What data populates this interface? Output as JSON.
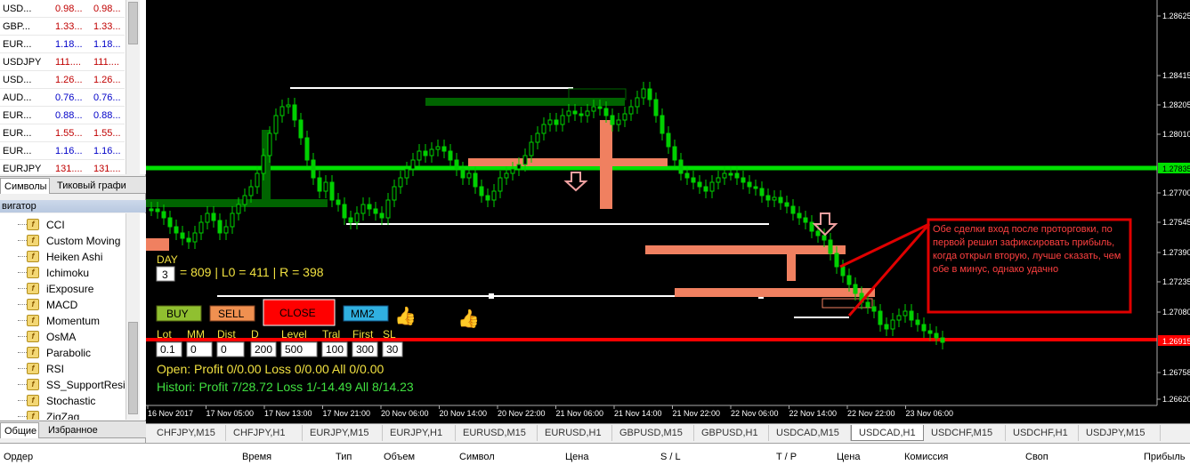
{
  "market_watch": {
    "rows": [
      {
        "symbol": "USD...",
        "bid": "0.98...",
        "ask": "0.98...",
        "up": false
      },
      {
        "symbol": "GBP...",
        "bid": "1.33...",
        "ask": "1.33...",
        "up": false
      },
      {
        "symbol": "EUR...",
        "bid": "1.18...",
        "ask": "1.18...",
        "up": true
      },
      {
        "symbol": "USDJPY",
        "bid": "111....",
        "ask": "111....",
        "up": false
      },
      {
        "symbol": "USD...",
        "bid": "1.26...",
        "ask": "1.26...",
        "up": false
      },
      {
        "symbol": "AUD...",
        "bid": "0.76...",
        "ask": "0.76...",
        "up": true
      },
      {
        "symbol": "EUR...",
        "bid": "0.88...",
        "ask": "0.88...",
        "up": true
      },
      {
        "symbol": "EUR...",
        "bid": "1.55...",
        "ask": "1.55...",
        "up": false
      },
      {
        "symbol": "EUR...",
        "bid": "1.16...",
        "ask": "1.16...",
        "up": true
      },
      {
        "symbol": "EURJPY",
        "bid": "131....",
        "ask": "131....",
        "up": false
      }
    ],
    "tabs": [
      "Символы",
      "Тиковый графи"
    ]
  },
  "navigator": {
    "title": "вигатор",
    "items": [
      "CCI",
      "Custom Moving",
      "Heiken Ashi",
      "Ichimoku",
      "iExposure",
      "MACD",
      "Momentum",
      "OsMA",
      "Parabolic",
      "RSI",
      "SS_SupportResist",
      "Stochastic",
      "ZigZag"
    ],
    "tabs": [
      "Общие",
      "Избранное"
    ],
    "icon_letter": "f"
  },
  "chart": {
    "price_labels": [
      "1.28625",
      "1.28415",
      "1.28205",
      "1.28010",
      "1.27700",
      "1.27545",
      "1.27390",
      "1.27235",
      "1.27080",
      "1.26758",
      "1.26620"
    ],
    "price_highlight_green": "1.27835",
    "price_highlight_red": "1.26915",
    "time_labels": [
      "16 Nov 2017",
      "17 Nov 05:00",
      "17 Nov 13:00",
      "17 Nov 21:00",
      "20 Nov 06:00",
      "20 Nov 14:00",
      "20 Nov 22:00",
      "21 Nov 06:00",
      "21 Nov 14:00",
      "21 Nov 22:00",
      "22 Nov 06:00",
      "22 Nov 14:00",
      "22 Nov 22:00",
      "23 Nov 06:00"
    ],
    "panel": {
      "day_label": "DAY",
      "day_value": "3",
      "stats": "= 809 | L0 = 411 | R = 398",
      "buttons": {
        "buy": "BUY",
        "sell": "SELL",
        "close": "CLOSE",
        "mm2": "MM2"
      },
      "param_labels": [
        "Lot",
        "MM",
        "Dist",
        "D",
        "Level",
        "Tral",
        "First",
        "SL"
      ],
      "param_values": [
        "0.1",
        "0",
        "0",
        "200",
        "500",
        "100",
        "300",
        "30"
      ],
      "open_line": "Open:  Profit 0/0.00  Loss 0/0.00  All 0/0.00",
      "history_line": "Histori:  Profit 7/28.72  Loss 1/-14.49  All 8/14.23"
    },
    "annotation": "Обе сделки вход после проторговки, по первой решил зафиксировать прибыль, когда открыл вторую, лучше сказать, чем обе в минус, однако удачно"
  },
  "chart_tabs": [
    "CHFJPY,M15",
    "CHFJPY,H1",
    "EURJPY,M15",
    "EURJPY,H1",
    "EURUSD,M15",
    "EURUSD,H1",
    "GBPUSD,M15",
    "GBPUSD,H1",
    "USDCAD,M15",
    "USDCAD,H1",
    "USDCHF,M15",
    "USDCHF,H1",
    "USDJPY,M15"
  ],
  "chart_tabs_active": "USDCAD,H1",
  "terminal_headers": [
    "Ордер",
    "Время",
    "Тип",
    "Объем",
    "Символ",
    "Цена",
    "S / L",
    "T / P",
    "Цена",
    "Комиссия",
    "Своп",
    "Прибыль"
  ],
  "colors": {
    "green_line": "#00e000",
    "red_line": "#ff0000",
    "salmon": "#f08060",
    "dark_green": "#006400",
    "annotation_red": "#e00000"
  }
}
